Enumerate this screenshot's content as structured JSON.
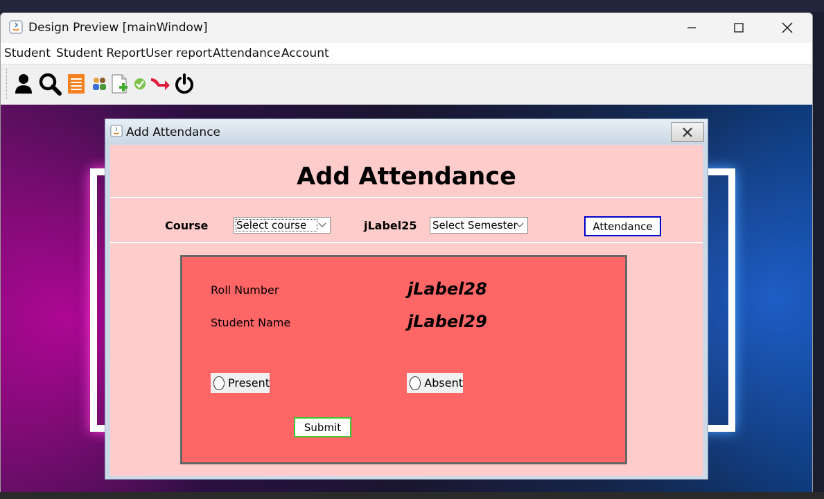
{
  "window": {
    "title": "Design Preview [mainWindow]"
  },
  "menu": {
    "items": [
      "Student",
      "Student Report",
      "User report",
      "Attendance",
      "Account"
    ]
  },
  "toolbar": {
    "icons": [
      "user-icon",
      "search-icon",
      "document-icon",
      "users-group-icon",
      "add-document-icon",
      "check-icon",
      "logout-arrow-icon",
      "power-icon"
    ]
  },
  "dialog": {
    "title": "Add Attendance",
    "heading": "Add Attendance",
    "course_label": "Course",
    "course_select": "Select course",
    "semester_label": "jLabel25",
    "semester_select": "Select Semester",
    "attendance_button": "Attendance",
    "roll_number_label": "Roll Number",
    "roll_number_value": "jLabel28",
    "student_name_label": "Student Name",
    "student_name_value": "jLabel29",
    "present_label": "Present",
    "absent_label": "Absent",
    "submit_label": "Submit"
  },
  "colors": {
    "dialog_bg": "#ffcccc",
    "panel_bg": "#ff6666",
    "attendance_btn_border": "#0000cc",
    "submit_btn_border": "#33cc33"
  }
}
